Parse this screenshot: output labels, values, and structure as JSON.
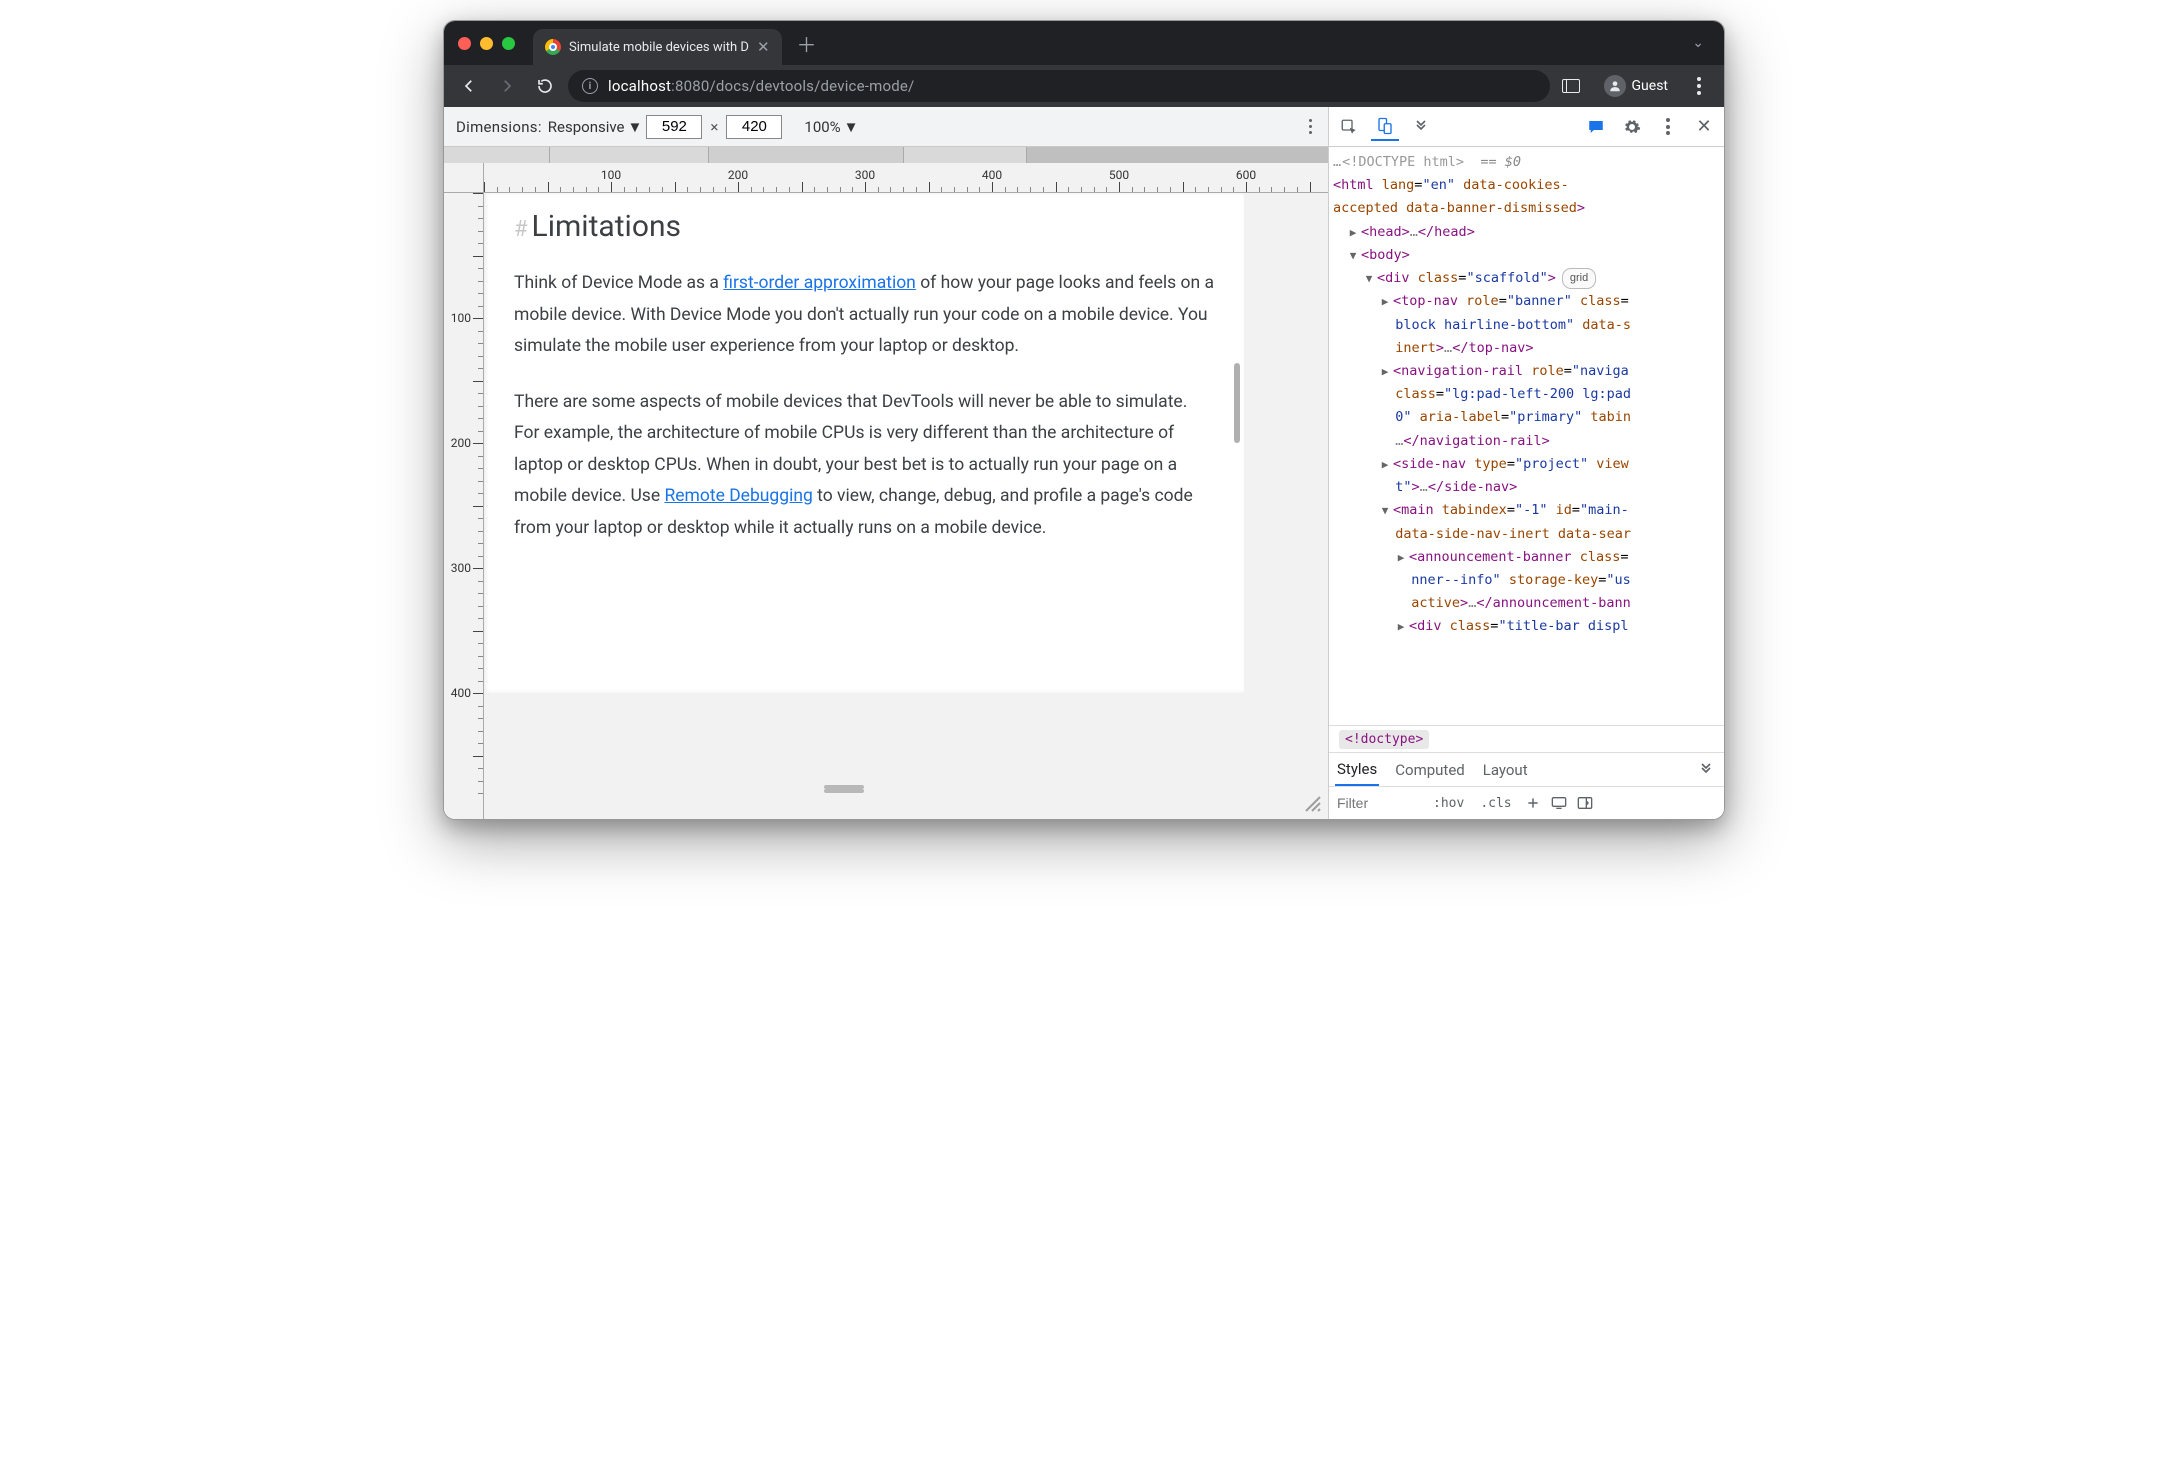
{
  "browser": {
    "tab_title": "Simulate mobile devices with D",
    "url_host": "localhost",
    "url_port_path": ":8080/docs/devtools/device-mode/",
    "guest_label": "Guest"
  },
  "device_toolbar": {
    "dimensions_label": "Dimensions:",
    "preset": "Responsive",
    "width": "592",
    "height": "420",
    "zoom": "100%"
  },
  "ruler": {
    "h_labels": [
      100,
      200,
      300,
      400,
      500,
      600
    ],
    "v_labels": [
      100,
      200,
      300,
      400
    ]
  },
  "page": {
    "heading": "Limitations",
    "p1_a": "Think of Device Mode as a ",
    "p1_link1": "first-order approximation",
    "p1_b": " of how your page looks and feels on a mobile device. With Device Mode you don't actually run your code on a mobile device. You simulate the mobile user experience from your laptop or desktop.",
    "p2_a": "There are some aspects of mobile devices that DevTools will never be able to simulate. For example, the architecture of mobile CPUs is very different than the architecture of laptop or desktop CPUs. When in doubt, your best bet is to actually run your page on a mobile device. Use ",
    "p2_link": "Remote Debugging",
    "p2_b": " to view, change, debug, and profile a page's code from your laptop or desktop while it actually runs on a mobile device."
  },
  "elements": {
    "doctype": "<!DOCTYPE html>",
    "eq_sel": "== $0",
    "html_open": {
      "tag": "html",
      "attrs": "lang=\"en\" data-cookies-accepted data-banner-dismissed"
    },
    "head": {
      "open": "<head>",
      "mid": "…",
      "close": "</head>"
    },
    "body_open": "<body>",
    "div_scaffold": {
      "t": "div",
      "a": "class=\"scaffold\"",
      "badge": "grid"
    },
    "topnav": {
      "t": "top-nav",
      "a": "role=\"banner\" class=\"block hairline-bottom\" data-s inert",
      "close": "</top-nav>"
    },
    "navrail": {
      "t": "navigation-rail",
      "a": "role=\"naviga class=\"lg:pad-left-200 lg:pad 0\" aria-label=\"primary\" tabin",
      "close": "</navigation-rail>"
    },
    "sidenav": {
      "t": "side-nav",
      "a": "type=\"project\" view t\"",
      "close": "</side-nav>"
    },
    "main": {
      "t": "main",
      "a": "tabindex=\"-1\" id=\"main-\" data-side-nav-inert data-sear"
    },
    "announcement": {
      "t": "announcement-banner",
      "a": "class= nner--info\" storage-key=\"us active",
      "close": "</announcement-bann"
    },
    "titlebar": {
      "t": "div",
      "a": "class=\"title-bar displ"
    }
  },
  "crumb": "<!doctype>",
  "styles": {
    "tab1": "Styles",
    "tab2": "Computed",
    "tab3": "Layout",
    "filter_ph": "Filter",
    "hov": ":hov",
    "cls": ".cls"
  }
}
